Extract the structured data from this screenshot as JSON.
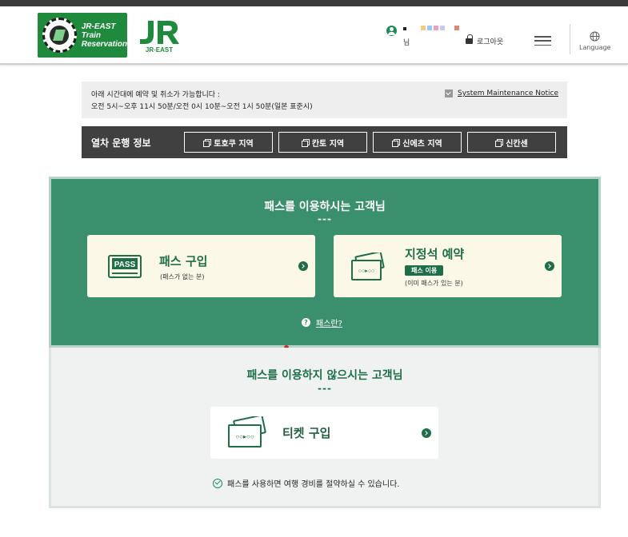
{
  "header": {
    "logo_text": [
      "JR-EAST",
      "Train",
      "Reservation"
    ],
    "jr_text": "JR·EAST",
    "user_suffix": "님",
    "logout_label": "로그아웃",
    "language_label": "Language"
  },
  "notice": {
    "line1": "아래 시간대에 예약 및 취소가 가능합니다 :",
    "line2": "오전 5시~오후 11시 50분/오전 0시 10분~오전 1시 50분(일본 표준시)",
    "maintenance_link": "System Maintenance Notice"
  },
  "train_info": {
    "title": "열차 운행 정보",
    "regions": [
      "토호쿠 지역",
      "칸토 지역",
      "신에츠 지역",
      "신칸센"
    ]
  },
  "pass_section": {
    "title": "패스를 이용하시는 고객님",
    "dash": "---",
    "buy_pass": {
      "title": "패스 구입",
      "sub": "(패스가 없는 분)",
      "icon_text": "PASS"
    },
    "reserve": {
      "title": "지정석 예약",
      "badge": "패스 이용",
      "sub": "(이미 패스가 있는 분)"
    },
    "help_link": "패스란?"
  },
  "nopass_section": {
    "title": "패스를 이용하지 않으시는 고객님",
    "dash": "---",
    "ticket": {
      "title": "티켓 구입"
    },
    "saving_note": "패스를 사용하면 여행 경비를 절약하실 수 있습니다."
  },
  "colors": {
    "brand_green": "#1f8a3b",
    "panel_green": "#3a8f6c",
    "card_title_green": "#1f6e4a",
    "dark_bar": "#404040"
  },
  "icons": [
    "user-icon",
    "lock-icon",
    "hamburger-icon",
    "globe-icon",
    "checkbox-icon",
    "copy-icon",
    "pass-card-icon",
    "ticket-icon",
    "arrow-right-icon",
    "help-icon",
    "check-circle-icon"
  ]
}
